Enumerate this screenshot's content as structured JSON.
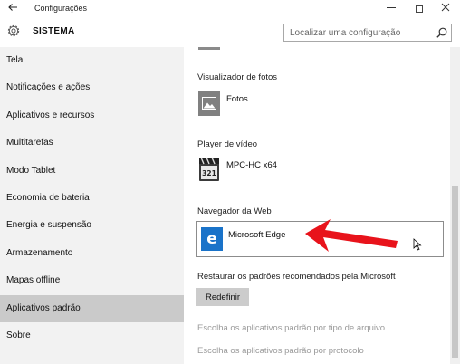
{
  "window": {
    "title": "Configurações",
    "back_icon": "back-arrow-icon",
    "minimize_glyph": "—",
    "close_glyph": "✕"
  },
  "header": {
    "title": "SISTEMA",
    "search_placeholder": "Localizar uma configuração"
  },
  "sidebar": {
    "items": [
      {
        "label": "Tela"
      },
      {
        "label": "Notificações e ações"
      },
      {
        "label": "Aplicativos e recursos"
      },
      {
        "label": "Multitarefas"
      },
      {
        "label": "Modo Tablet"
      },
      {
        "label": "Economia de bateria"
      },
      {
        "label": "Energia e suspensão"
      },
      {
        "label": "Armazenamento"
      },
      {
        "label": "Mapas offline"
      },
      {
        "label": "Aplicativos padrão"
      },
      {
        "label": "Sobre"
      }
    ],
    "active_label": "Aplicativos padrão"
  },
  "main": {
    "photo_viewer": {
      "label": "Visualizador de fotos",
      "app": "Fotos"
    },
    "video_player": {
      "label": "Player de vídeo",
      "app": "MPC-HC x64",
      "icon_text": "321"
    },
    "web_browser": {
      "label": "Navegador da Web",
      "app": "Microsoft Edge",
      "icon_letter": "e"
    },
    "reset": {
      "label": "Restaurar os padrões recomendados pela Microsoft",
      "button": "Redefinir"
    },
    "links": [
      "Escolha os aplicativos padrão por tipo de arquivo",
      "Escolha os aplicativos padrão por protocolo"
    ]
  },
  "colors": {
    "sidebar_bg": "#f2f2f2",
    "active_item_bg": "#cacaca",
    "edge_blue": "#1a73c9",
    "annotation_red": "#e8131b"
  }
}
